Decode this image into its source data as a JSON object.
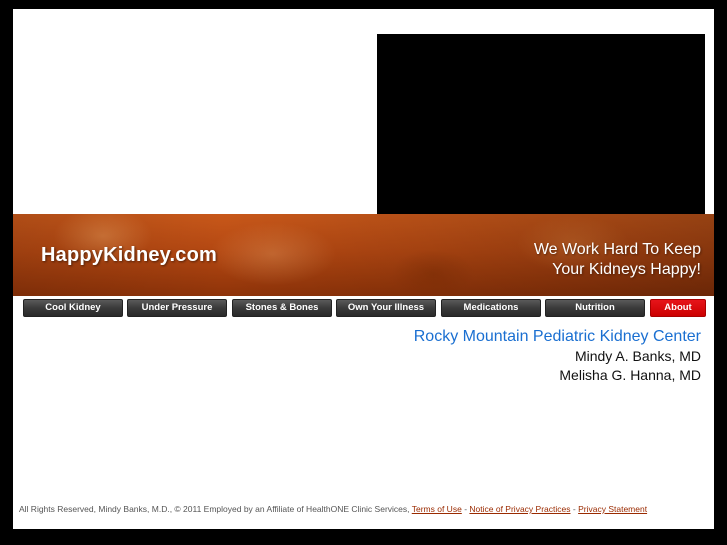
{
  "header": {
    "logo": "HappyKidney.com",
    "tagline_line1": "We Work Hard To Keep",
    "tagline_line2": "Your Kidneys Happy!"
  },
  "nav": {
    "items": [
      {
        "label": "Cool Kidney"
      },
      {
        "label": "Under Pressure"
      },
      {
        "label": "Stones & Bones"
      },
      {
        "label": "Own Your Illness"
      },
      {
        "label": "Medications"
      },
      {
        "label": "Nutrition"
      },
      {
        "label": "About",
        "active": true
      }
    ]
  },
  "content": {
    "center_name": "Rocky Mountain Pediatric Kidney Center",
    "doctors": [
      "Mindy A. Banks, MD",
      "Melisha G. Hanna, MD"
    ]
  },
  "footer": {
    "text": "All Rights Reserved, Mindy Banks, M.D., © 2011 Employed by an Affiliate of HealthONE Clinic Services,",
    "links": [
      "Terms of Use",
      "Notice of Privacy Practices",
      "Privacy Statement"
    ],
    "separator": "-"
  },
  "colors": {
    "banner": "#b44812",
    "nav_button": "#3a3a3a",
    "nav_active": "#cc0000",
    "center_name": "#1a6fd1",
    "footer_link": "#9a2a00"
  }
}
